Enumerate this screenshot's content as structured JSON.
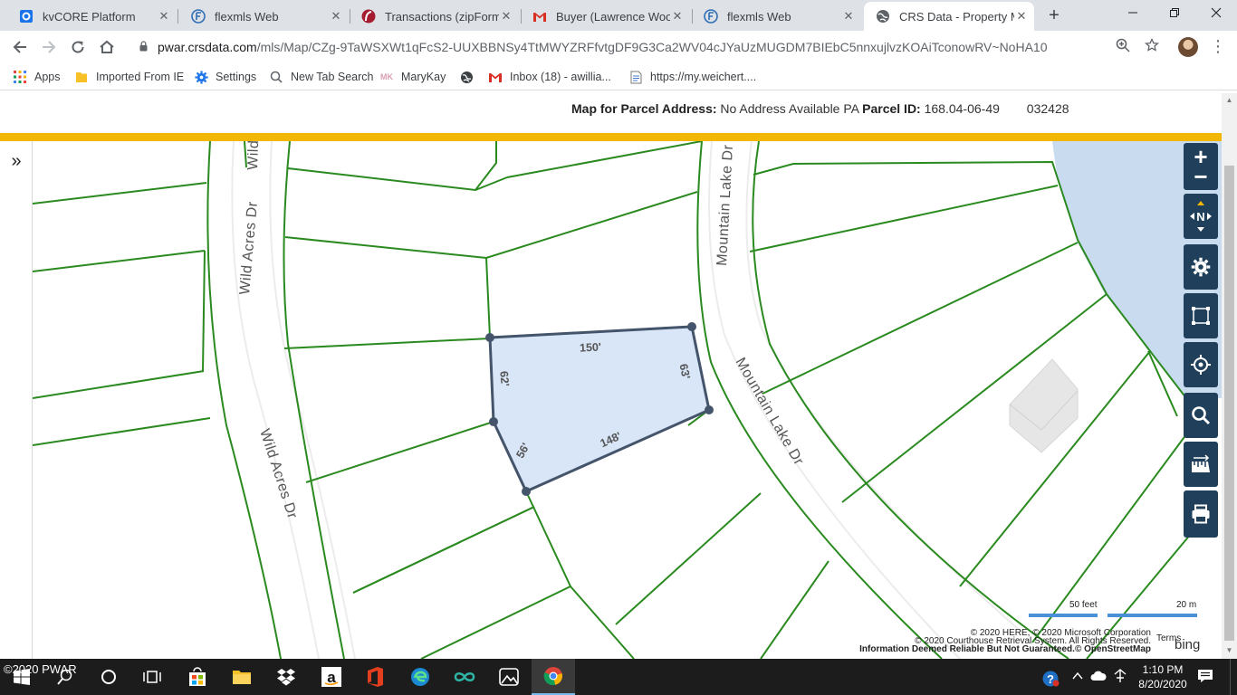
{
  "browser": {
    "tabs": [
      {
        "label": "kvCORE Platform",
        "icon": "kvcore-icon",
        "active": false
      },
      {
        "label": "flexmls Web",
        "icon": "flexmls-icon",
        "active": false
      },
      {
        "label": "Transactions (zipForm E",
        "icon": "zipform-icon",
        "active": false
      },
      {
        "label": "Buyer (Lawrence Wood",
        "icon": "gmail-icon",
        "active": false
      },
      {
        "label": "flexmls Web",
        "icon": "flexmls-icon",
        "active": false
      },
      {
        "label": "CRS Data - Property M",
        "icon": "globe-icon",
        "active": true
      }
    ],
    "new_tab": "+",
    "url_host": "pwar.crsdata.com",
    "url_path": "/mls/Map/CZg-9TaWSXWt1qFcS2-UUXBBNSy4TtMWYZRFfvtgDF9G3Ca2WV04cJYaUzMUGDM7BIEbC5nnxujlvzKOAiTconowRV~NoHA10",
    "bookmarks": [
      {
        "label": "Apps",
        "icon": "apps-grid-icon"
      },
      {
        "label": "Imported From IE",
        "icon": "folder-icon"
      },
      {
        "label": "Settings",
        "icon": "gear-icon"
      },
      {
        "label": "New Tab Search",
        "icon": "search-icon"
      },
      {
        "label": "MaryKay",
        "icon": "marykay-icon"
      },
      {
        "label": "",
        "icon": "globe-dark-icon"
      },
      {
        "label": "Inbox (18) - awillia...",
        "icon": "gmail-icon"
      },
      {
        "label": "https://my.weichert....",
        "icon": "page-icon"
      }
    ]
  },
  "page": {
    "header_label": "Map for Parcel Address:",
    "address": "No Address Available PA",
    "parcel_id_label": "Parcel ID:",
    "parcel_id": "168.04-06-49",
    "parcel_extra": "032428"
  },
  "map": {
    "roads": [
      "Wild Acres Dr",
      "Wild",
      "Wild Acres Dr",
      "Mountain Lake Dr",
      "Mountain Lake Dr"
    ],
    "dimensions": [
      "150'",
      "63'",
      "148'",
      "56'",
      "62'"
    ],
    "scale_feet": "50 feet",
    "scale_meters": "20 m",
    "attribution": [
      "© 2020 HERE, © 2020 Microsoft Corporation",
      "© 2020 Courthouse Retrieval System. All Rights Reserved.",
      "Information Deemed Reliable But Not Guaranteed.© OpenStreetMap"
    ],
    "terms": "Terms",
    "bing": "bing",
    "tools": [
      "zoom-in",
      "zoom-out",
      "compass",
      "settings",
      "select-area",
      "locate",
      "search",
      "measure",
      "print"
    ],
    "compass_letter": "N",
    "colors": {
      "parcel_lines": "#2a8a1f",
      "selected_fill": "#d8e6f8",
      "selected_stroke": "#44546a",
      "water": "#c9dcef",
      "tool_bg": "#1f3f5a",
      "header_bar": "#f2b705"
    }
  },
  "taskbar": {
    "watermark": "©2020 PWAR",
    "time": "1:10 PM",
    "date": "8/20/2020",
    "apps": [
      "start",
      "search",
      "task-view",
      "store",
      "file-explorer",
      "dropbox",
      "amazon",
      "office",
      "edge",
      "infinity",
      "photos",
      "chrome"
    ]
  }
}
